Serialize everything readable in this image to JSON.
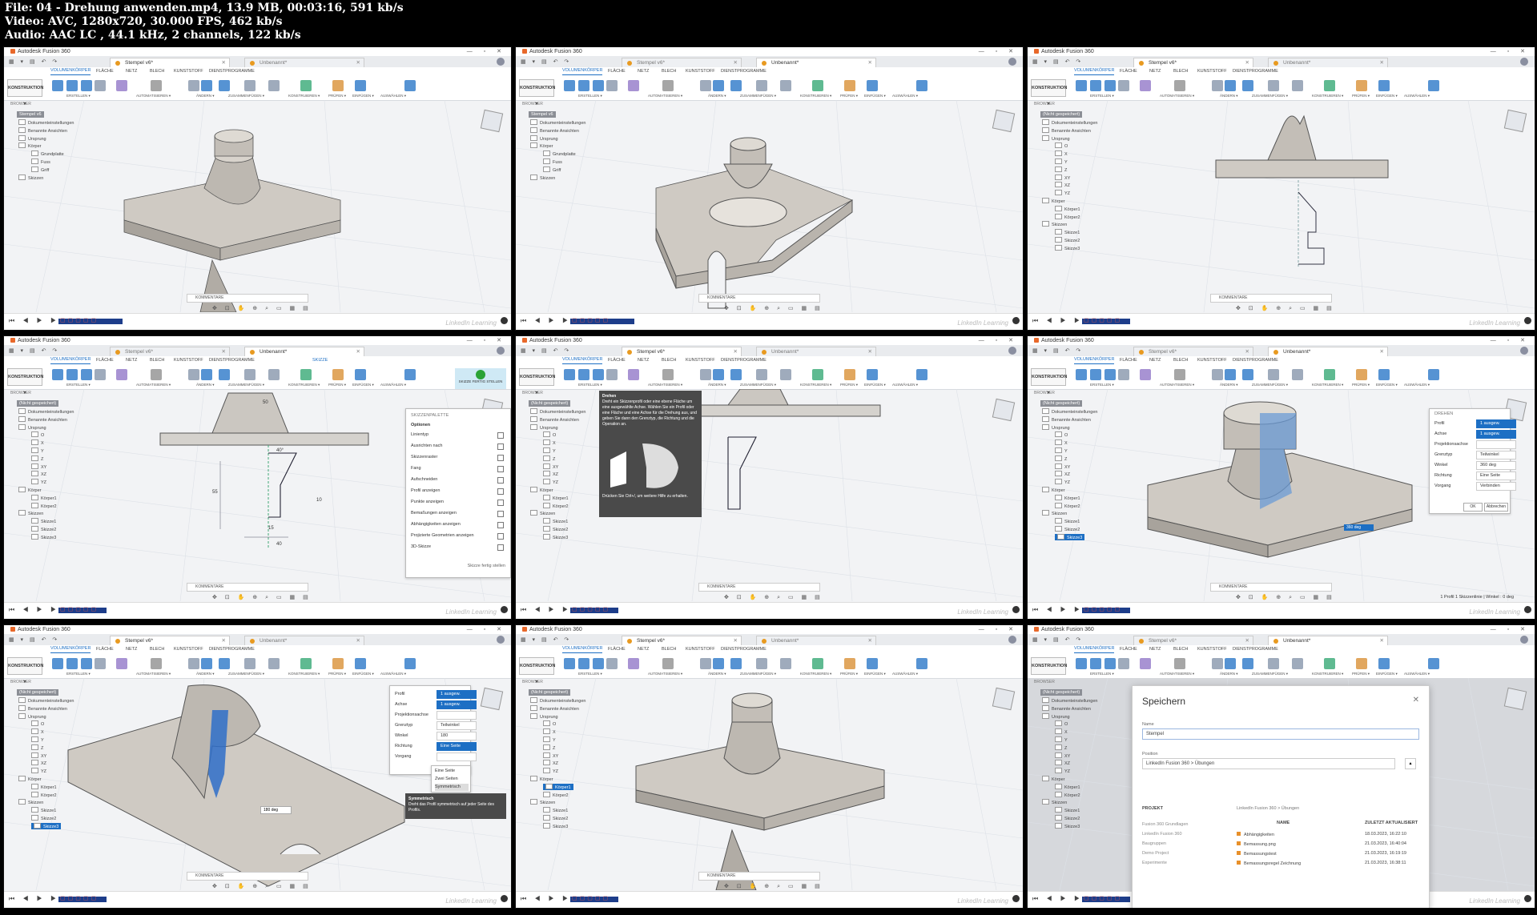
{
  "header": {
    "line1": "File: 04 - Drehung anwenden.mp4, 13.9 MB, 00:03:16, 591 kb/s",
    "line2": "Video: AVC, 1280x720, 30.000 FPS, 462 kb/s",
    "line3": "Audio: AAC LC , 44.1 kHz, 2 channels, 122 kb/s"
  },
  "app": {
    "title": "Autodesk Fusion 360",
    "tab_active": "Stempel v6*",
    "tab_other": "Unbenannt*",
    "menu": [
      "VOLUMENKÖRPER",
      "FLÄCHE",
      "NETZ",
      "BLECH",
      "KUNSTSTOFF",
      "DIENSTPROGRAMME"
    ],
    "sketch_menu": "SKIZZE",
    "workspace": "KONSTRUKTION ▾",
    "groups": [
      "ERSTELLEN ▾",
      "AUTOMATISIEREN ▾",
      "ÄNDERN ▾",
      "ZUSAMMENFÜGEN ▾",
      "KONSTRUIEREN ▾",
      "PRÜFEN ▾",
      "EINFÜGEN ▾",
      "AUSWÄHLEN ▾"
    ],
    "browser_label": "BROWSER",
    "comment_label": "KOMMENTARE",
    "watermark": "LinkedIn Learning"
  },
  "browser": {
    "root_a": "Stempel v6",
    "root_b": "(Nicht gespeichert)",
    "items_a": [
      "Dokumenteinstellungen",
      "Benannte Ansichten",
      "Ursprung",
      "Körper",
      "Grundplatte",
      "Fuss",
      "Griff",
      "Skizzen"
    ],
    "items_b": [
      "Dokumenteinstellungen",
      "Benannte Ansichten",
      "Ursprung",
      "O",
      "X",
      "Y",
      "Z",
      "XY",
      "XZ",
      "YZ",
      "Körper",
      "Körper1",
      "Körper2",
      "Skizzen",
      "Skizze1",
      "Skizze2",
      "Skizze3"
    ]
  },
  "frame4": {
    "sketch_palette": "SKIZZENPALETTE",
    "options": "Optionen",
    "rows": [
      "Linientyp",
      "Ausrichten nach",
      "Skizzenraster",
      "Fang",
      "Aufschneiden",
      "Profil anzeigen",
      "Punkte anzeigen",
      "Bemaßungen anzeigen",
      "Abhängigkeiten anzeigen",
      "Projizierte Geometrien anzeigen",
      "3D-Skizze"
    ],
    "finish": "Skizze fertig stellen",
    "finish_btn": "SKIZZE FERTIG STELLEN",
    "dims": [
      "50",
      "40°",
      "55",
      "15",
      "10",
      "40"
    ]
  },
  "frame5": {
    "tip_title": "Drehen",
    "tip_text": "Dreht ein Skizzenprofil oder eine ebene Fläche um eine ausgewählte Achse. Wählen Sie ein Profil oder eine Fläche und eine Achse für die Drehung aus, und geben Sie dann den Grenztyp, die Richtung und die Operation an.",
    "tip_footer": "Drücken Sie Ctrl+/, um weitere Hilfe zu erhalten."
  },
  "frame6": {
    "panel_title": "DREHEN",
    "rows": [
      [
        "Profil",
        "1 ausgew."
      ],
      [
        "Achse",
        "1 ausgew."
      ],
      [
        "Projektionsachse",
        ""
      ],
      [
        "Grenztyp",
        "Teilwinkel"
      ],
      [
        "Winkel",
        "360 deg"
      ],
      [
        "Richtung",
        "Eine Seite"
      ],
      [
        "Vorgang",
        "Verbinden"
      ]
    ],
    "ok": "OK",
    "cancel": "Abbrechen",
    "status": "1 Profil 1 Skizzenlinie | Winkel : 0 deg",
    "field": "360 deg"
  },
  "frame7": {
    "rows": [
      [
        "Profil",
        "1 ausgew."
      ],
      [
        "Achse",
        "1 ausgew."
      ],
      [
        "Projektionsachse",
        ""
      ],
      [
        "Grenztyp",
        "Teilwinkel"
      ],
      [
        "Winkel",
        "180"
      ],
      [
        "Richtung",
        "Eine Seite"
      ],
      [
        "Vorgang",
        ""
      ]
    ],
    "dropdown": [
      "Eine Seite",
      "Zwei Seiten",
      "Symmetrisch"
    ],
    "tip_title": "Symmetrisch",
    "tip_text": "Dreht das Profil symmetrisch auf jeder Seite des Profils.",
    "field": "180 deg"
  },
  "frame9": {
    "dialog_title": "Speichern",
    "name_label": "Name",
    "name_value": "Stempel",
    "location_label": "Position",
    "location_value": "LinkedIn Fusion 360 > Übungen",
    "project_label": "PROJEKT",
    "projects": [
      "Fusion 360 Grundlagen",
      "LinkedIn Fusion 360",
      "Baugruppen",
      "Demo Project",
      "Experimente"
    ],
    "crumb": "LinkedIn Fusion 360 > Übungen",
    "col_name": "NAME",
    "col_date": "ZULETZT AKTUALISIERT",
    "files": [
      [
        "Abhängigkeiten",
        "18.03.2023, 16:22:10"
      ],
      [
        "Bemassung.png",
        "21.03.2023, 16:40:04"
      ],
      [
        "Bemassungstest",
        "21.03.2023, 16:19:19"
      ],
      [
        "Bemassungsregel Zeichnung",
        "21.03.2023, 16:38:11"
      ]
    ]
  },
  "colors": {
    "accent": "#1d6fc4",
    "bg": "#f2f3f5",
    "part": "#c9c4bd"
  }
}
